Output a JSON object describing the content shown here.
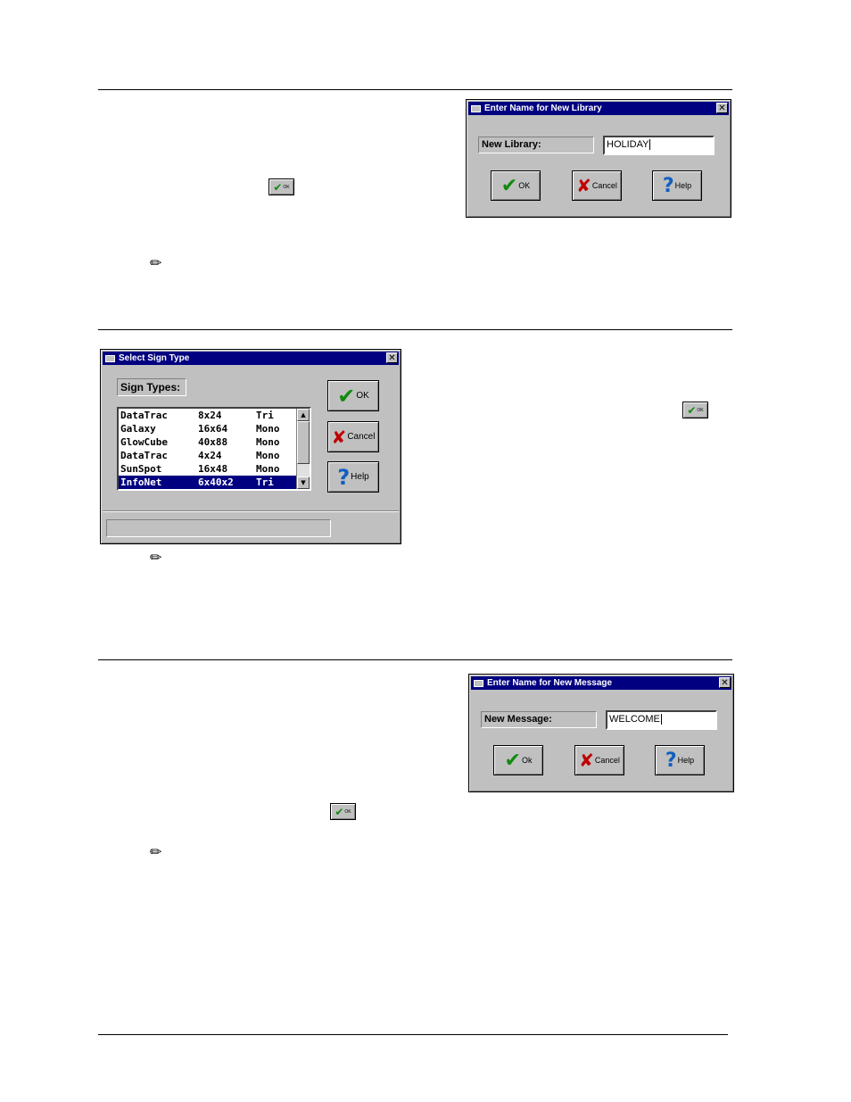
{
  "dialog_library": {
    "title": "Enter Name for New Library",
    "close": "✕",
    "label": "New Library:",
    "value": "HOLIDAY",
    "ok": "OK",
    "cancel": "Cancel",
    "help": "Help"
  },
  "dialog_sign": {
    "title": "Select Sign Type",
    "close": "✕",
    "label": "Sign Types:",
    "rows": [
      {
        "name": "DataTrac",
        "size": "8x24",
        "color": "Tri"
      },
      {
        "name": "Galaxy",
        "size": "16x64",
        "color": "Mono"
      },
      {
        "name": "GlowCube",
        "size": "40x88",
        "color": "Mono"
      },
      {
        "name": "DataTrac",
        "size": "4x24",
        "color": "Mono"
      },
      {
        "name": "SunSpot",
        "size": "16x48",
        "color": "Mono"
      },
      {
        "name": "InfoNet",
        "size": "6x40x2",
        "color": "Tri"
      }
    ],
    "selected_index": 5,
    "ok": "OK",
    "cancel": "Cancel",
    "help": "Help"
  },
  "dialog_message": {
    "title": "Enter Name for New Message",
    "close": "✕",
    "label": "New Message:",
    "value": "WELCOME",
    "ok": "Ok",
    "cancel": "Cancel",
    "help": "Help"
  },
  "inline_ok_button": {
    "icon": "check-icon",
    "label": "OK"
  },
  "note_icon": "pencil-icon",
  "colors": {
    "titlebar": "#000080",
    "dialog": "#c0c0c0",
    "check": "#108a10",
    "cross": "#c00000",
    "help": "#1060c0"
  }
}
